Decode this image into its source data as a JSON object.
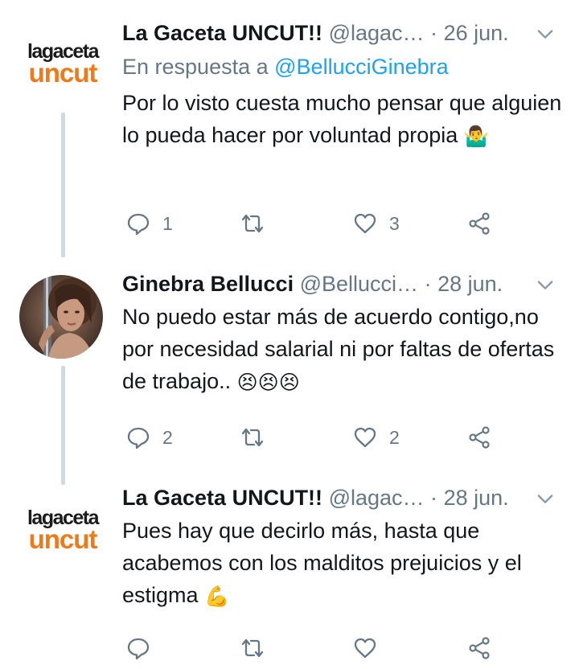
{
  "colors": {
    "accent": "#1da1f2",
    "muted": "#657786",
    "thread_line": "#cfd9de",
    "logo_orange": "#f07a1a"
  },
  "tweets": [
    {
      "name": "La Gaceta UNCUT!!",
      "handle": "@lagac…",
      "separator": "·",
      "date": "26 jun.",
      "reply_prefix": "En respuesta a",
      "reply_mention": "@BellucciGinebra",
      "text": "Por lo visto cuesta mucho pensar que alguien lo pueda hacer por voluntad propia",
      "emoji": "🤷‍♂️",
      "replies": "1",
      "retweets": "",
      "likes": "3",
      "avatar_logo": {
        "line1": "lagaceta",
        "line2": "uncut"
      }
    },
    {
      "name": "Ginebra Bellucci",
      "handle": "@Bellucci…",
      "separator": "·",
      "date": "28 jun.",
      "text": "No puedo estar más de acuerdo contigo,no por necesidad salarial ni por faltas de ofertas de trabajo..",
      "emoji": "😣😣😣",
      "replies": "2",
      "retweets": "",
      "likes": "2"
    },
    {
      "name": "La Gaceta UNCUT!!",
      "handle": "@lagac…",
      "separator": "·",
      "date": "28 jun.",
      "text": "Pues hay que decirlo más, hasta que acabemos con los malditos prejuicios y el estigma",
      "emoji": "💪",
      "replies": "",
      "retweets": "",
      "likes": "",
      "avatar_logo": {
        "line1": "lagaceta",
        "line2": "uncut"
      }
    }
  ],
  "icons": {
    "chevron": "chevron-down-icon",
    "reply": "reply-icon",
    "retweet": "retweet-icon",
    "like": "heart-icon",
    "share": "share-icon"
  }
}
